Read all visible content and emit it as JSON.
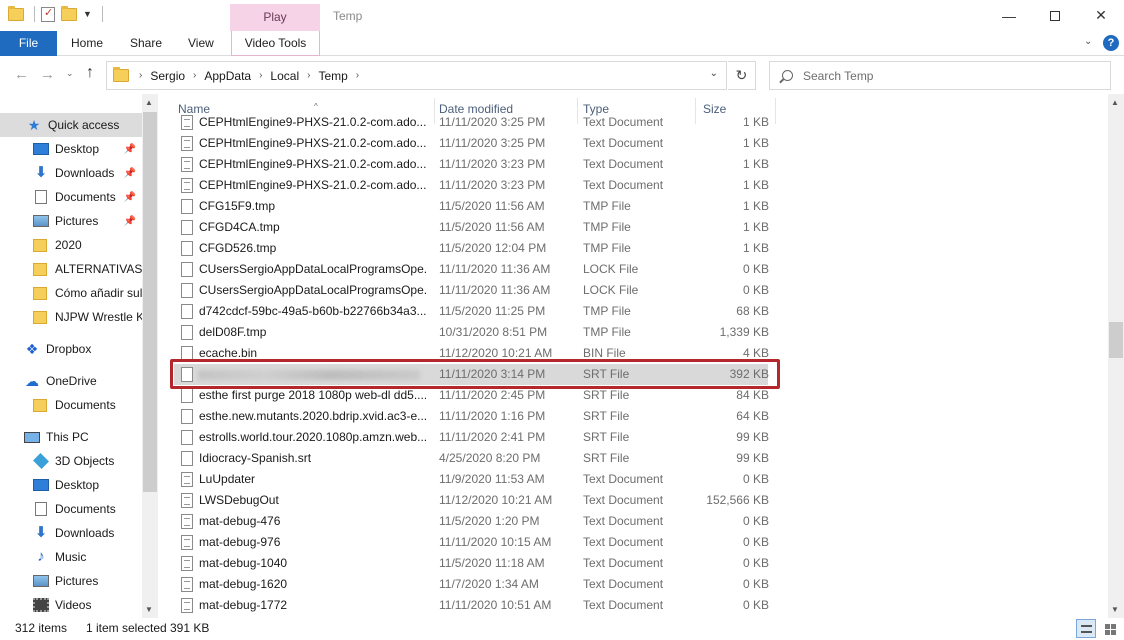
{
  "window": {
    "title": "Temp",
    "context_tab_group": "Play"
  },
  "ribbon": {
    "tabs": [
      "File",
      "Home",
      "Share",
      "View",
      "Video Tools"
    ]
  },
  "address": {
    "crumbs": [
      "Sergio",
      "AppData",
      "Local",
      "Temp"
    ]
  },
  "search": {
    "placeholder": "Search Temp"
  },
  "nav": {
    "items": [
      {
        "label": "Quick access",
        "icon": "star-icon",
        "pinned": false
      },
      {
        "label": "Desktop",
        "icon": "desktop-icon",
        "pinned": true
      },
      {
        "label": "Downloads",
        "icon": "download-icon",
        "pinned": true
      },
      {
        "label": "Documents",
        "icon": "document-icon",
        "pinned": true
      },
      {
        "label": "Pictures",
        "icon": "pictures-icon",
        "pinned": true
      },
      {
        "label": "2020",
        "icon": "folder-icon",
        "pinned": false
      },
      {
        "label": "ALTERNATIVAS X",
        "icon": "folder-icon",
        "pinned": false
      },
      {
        "label": "Cómo añadir sul",
        "icon": "folder-icon",
        "pinned": false
      },
      {
        "label": "NJPW Wrestle Ki",
        "icon": "folder-icon",
        "pinned": false
      },
      {
        "label": "Dropbox",
        "icon": "dropbox-icon",
        "pinned": false
      },
      {
        "label": "OneDrive",
        "icon": "cloud-icon",
        "pinned": false
      },
      {
        "label": "Documents",
        "icon": "folder-icon",
        "pinned": false
      },
      {
        "label": "This PC",
        "icon": "computer-icon",
        "pinned": false
      },
      {
        "label": "3D Objects",
        "icon": "cube-icon",
        "pinned": false
      },
      {
        "label": "Desktop",
        "icon": "desktop-icon",
        "pinned": false
      },
      {
        "label": "Documents",
        "icon": "document-icon",
        "pinned": false
      },
      {
        "label": "Downloads",
        "icon": "download-icon",
        "pinned": false
      },
      {
        "label": "Music",
        "icon": "music-icon",
        "pinned": false
      },
      {
        "label": "Pictures",
        "icon": "pictures-icon",
        "pinned": false
      },
      {
        "label": "Videos",
        "icon": "video-icon",
        "pinned": false
      }
    ]
  },
  "columns": {
    "name": "Name",
    "date": "Date modified",
    "type": "Type",
    "size": "Size"
  },
  "files": [
    {
      "name": "CEPHtmlEngine9-PHXS-21.0.2-com.ado...",
      "date": "11/11/2020 3:25 PM",
      "type": "Text Document",
      "size": "1 KB"
    },
    {
      "name": "CEPHtmlEngine9-PHXS-21.0.2-com.ado...",
      "date": "11/11/2020 3:25 PM",
      "type": "Text Document",
      "size": "1 KB"
    },
    {
      "name": "CEPHtmlEngine9-PHXS-21.0.2-com.ado...",
      "date": "11/11/2020 3:23 PM",
      "type": "Text Document",
      "size": "1 KB"
    },
    {
      "name": "CEPHtmlEngine9-PHXS-21.0.2-com.ado...",
      "date": "11/11/2020 3:23 PM",
      "type": "Text Document",
      "size": "1 KB"
    },
    {
      "name": "CFG15F9.tmp",
      "date": "11/5/2020 11:56 AM",
      "type": "TMP File",
      "size": "1 KB"
    },
    {
      "name": "CFGD4CA.tmp",
      "date": "11/5/2020 11:56 AM",
      "type": "TMP File",
      "size": "1 KB"
    },
    {
      "name": "CFGD526.tmp",
      "date": "11/5/2020 12:04 PM",
      "type": "TMP File",
      "size": "1 KB"
    },
    {
      "name": "CUsersSergioAppDataLocalProgramsOpe...",
      "date": "11/11/2020 11:36 AM",
      "type": "LOCK File",
      "size": "0 KB"
    },
    {
      "name": "CUsersSergioAppDataLocalProgramsOpe...",
      "date": "11/11/2020 11:36 AM",
      "type": "LOCK File",
      "size": "0 KB"
    },
    {
      "name": "d742cdcf-59bc-49a5-b60b-b22766b34a3...",
      "date": "11/5/2020 11:25 PM",
      "type": "TMP File",
      "size": "68 KB"
    },
    {
      "name": "delD08F.tmp",
      "date": "10/31/2020 8:51 PM",
      "type": "TMP File",
      "size": "1,339 KB"
    },
    {
      "name": "ecache.bin",
      "date": "11/12/2020 10:21 AM",
      "type": "BIN File",
      "size": "4 KB"
    },
    {
      "name": "",
      "date": "11/11/2020 3:14 PM",
      "type": "SRT File",
      "size": "392 KB"
    },
    {
      "name": "esthe first purge 2018 1080p web-dl dd5....",
      "date": "11/11/2020 2:45 PM",
      "type": "SRT File",
      "size": "84 KB"
    },
    {
      "name": "esthe.new.mutants.2020.bdrip.xvid.ac3-e...",
      "date": "11/11/2020 1:16 PM",
      "type": "SRT File",
      "size": "64 KB"
    },
    {
      "name": "estrolls.world.tour.2020.1080p.amzn.web...",
      "date": "11/11/2020 2:41 PM",
      "type": "SRT File",
      "size": "99 KB"
    },
    {
      "name": "Idiocracy-Spanish.srt",
      "date": "4/25/2020 8:20 PM",
      "type": "SRT File",
      "size": "99 KB"
    },
    {
      "name": "LuUpdater",
      "date": "11/9/2020 11:53 AM",
      "type": "Text Document",
      "size": "0 KB"
    },
    {
      "name": "LWSDebugOut",
      "date": "11/12/2020 10:21 AM",
      "type": "Text Document",
      "size": "152,566 KB"
    },
    {
      "name": "mat-debug-476",
      "date": "11/5/2020 1:20 PM",
      "type": "Text Document",
      "size": "0 KB"
    },
    {
      "name": "mat-debug-976",
      "date": "11/11/2020 10:15 AM",
      "type": "Text Document",
      "size": "0 KB"
    },
    {
      "name": "mat-debug-1040",
      "date": "11/5/2020 11:18 AM",
      "type": "Text Document",
      "size": "0 KB"
    },
    {
      "name": "mat-debug-1620",
      "date": "11/7/2020 1:34 AM",
      "type": "Text Document",
      "size": "0 KB"
    },
    {
      "name": "mat-debug-1772",
      "date": "11/11/2020 10:51 AM",
      "type": "Text Document",
      "size": "0 KB"
    }
  ],
  "status": {
    "item_count": "312 items",
    "selection": "1 item selected",
    "selection_size": "391 KB"
  },
  "colors": {
    "file_tab": "#1f6bbf",
    "context_tab": "#f6d3e6",
    "highlight_border": "#b3272d"
  }
}
